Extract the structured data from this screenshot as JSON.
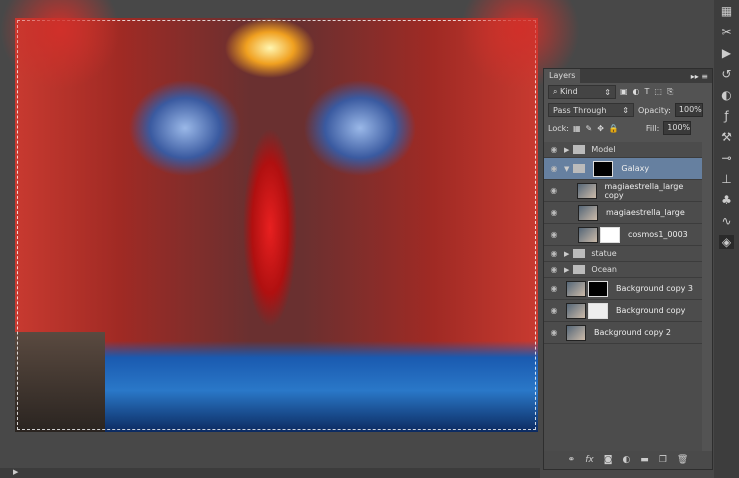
{
  "layers_panel": {
    "tab": "Layers",
    "filter_kind": "Kind",
    "blend_mode": "Pass Through",
    "opacity_label": "Opacity:",
    "opacity": "100%",
    "lock_label": "Lock:",
    "fill_label": "Fill:",
    "fill": "100%",
    "layers": [
      {
        "name": "Model",
        "type": "group"
      },
      {
        "name": "Galaxy",
        "type": "group",
        "expanded": true,
        "selected": true
      },
      {
        "name": "magiaestrella_large copy",
        "type": "layer"
      },
      {
        "name": "magiaestrella_large",
        "type": "layer"
      },
      {
        "name": "cosmos1_0003",
        "type": "layer"
      },
      {
        "name": "statue",
        "type": "group"
      },
      {
        "name": "Ocean",
        "type": "group"
      },
      {
        "name": "Background copy 3",
        "type": "layer"
      },
      {
        "name": "Background copy",
        "type": "layer"
      },
      {
        "name": "Background copy 2",
        "type": "layer"
      }
    ],
    "footer_icons": [
      "link-icon",
      "fx-icon",
      "mask-icon",
      "adjustment-icon",
      "folder-icon",
      "new-layer-icon",
      "trash-icon"
    ]
  },
  "status": {
    "arrow": "▶"
  }
}
